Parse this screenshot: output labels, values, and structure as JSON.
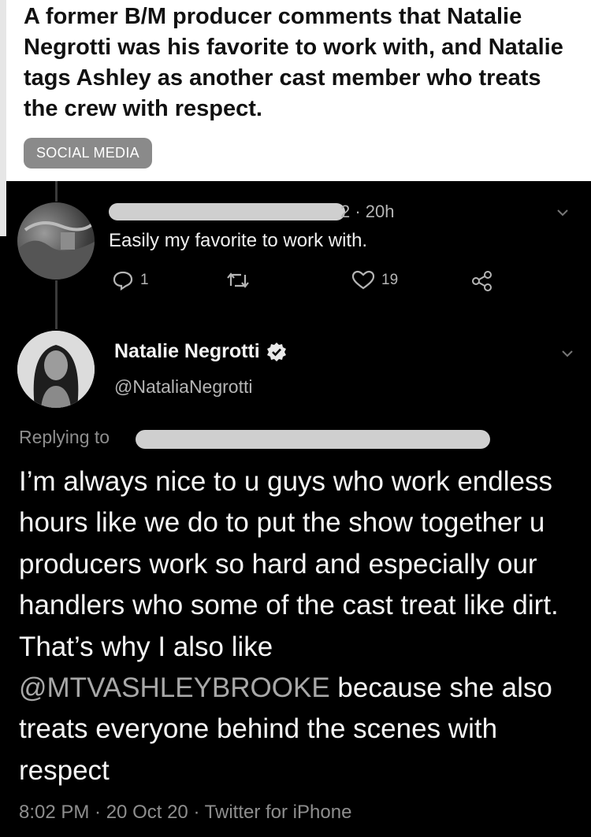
{
  "header": {
    "headline": "A former B/M producer comments that Natalie Negrotti was his favorite to work with, and Natalie tags Ashley as another cast member who treats the crew with respect.",
    "tag": "SOCIAL MEDIA"
  },
  "reply_tweet": {
    "time_suffix": "2 · 20h",
    "text": "Easily my favorite to work with.",
    "reply_count": "1",
    "like_count": "19"
  },
  "main_tweet": {
    "display_name": "Natalie Negrotti",
    "handle": "@NataliaNegrotti",
    "replying_prefix": "Replying to",
    "text_before": "I’m always nice to u guys who work endless hours like we do to put the show together u producers work so hard and especially our handlers who some of the cast treat like dirt. That’s why I also like ",
    "mention": "@MTVASHLEYBROOKE",
    "text_after": " because she also treats everyone behind the scenes with respect",
    "timestamp": "8:02 PM · 20 Oct 20 · Twitter for iPhone"
  },
  "icons": [
    "reply-icon",
    "retweet-icon",
    "like-icon",
    "share-icon",
    "verified-badge-icon",
    "chevron-down-icon"
  ]
}
